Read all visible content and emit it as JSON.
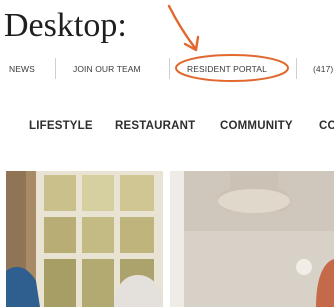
{
  "heading": "Desktop:",
  "top_nav": {
    "items": [
      {
        "label": "NEWS"
      },
      {
        "label": "JOIN OUR TEAM"
      },
      {
        "label": "RESIDENT PORTAL"
      },
      {
        "label": "(417)"
      }
    ]
  },
  "main_nav": {
    "items": [
      {
        "label": "LIFESTYLE"
      },
      {
        "label": "RESTAURANT"
      },
      {
        "label": "COMMUNITY"
      },
      {
        "label": "CO"
      }
    ]
  },
  "annotation": {
    "color": "#e2672d"
  },
  "images": [
    {
      "subject": "window-with-residents"
    },
    {
      "subject": "dining-room-with-chandelier"
    }
  ]
}
